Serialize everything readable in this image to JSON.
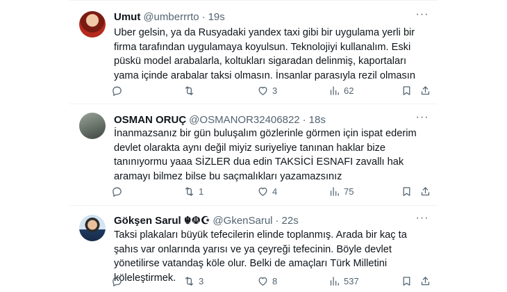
{
  "tweets": [
    {
      "name": "Umut",
      "handle": "@umberrrto",
      "dot": "·",
      "time": "19s",
      "text": "Uber gelsin, ya da Rusyadaki yandex taxi gibi bir uygulama yerli bir firma tarafından uygulamaya koyulsun. Teknolojiyi kullanalım. Eski püskü model arabalarla, koltukları sigaradan delinmiş, kaportaları yama içinde arabalar taksi olmasın. İnsanlar parasıyla rezil olmasın",
      "replies": "",
      "retweets": "",
      "likes": "3",
      "views": "62"
    },
    {
      "name": "OSMAN ORUÇ",
      "handle": "@OSMANOR32406822",
      "dot": "·",
      "time": "18s",
      "text": "İnanmazsanız bir gün buluşalım gözlerinle görmen için ispat ederim devlet olarakta aynı değil miyiz suriyeliye tanınan haklar bize tanınıyormu yaaa SİZLER dua edin TAKSİCİ ESNAFI zavallı hak aramayı bilmez bilse bu saçmalıkları yazamazsınız",
      "replies": "",
      "retweets": "1",
      "likes": "4",
      "views": "75"
    },
    {
      "name": "Gökşen Sarul ☬☫☪",
      "handle": "@GkenSarul",
      "dot": "·",
      "time": "22s",
      "text": "Taksi plakaları büyük tefecilerin elinde toplanmış. Arada bir kaç ta şahıs var onlarında yarısı ve ya çeyreği tefecinin. Böyle devlet yönetilirse vatandaş köle olur. Belki de amaçları Türk Milletini köleleştirmek.",
      "replies": "",
      "retweets": "3",
      "likes": "8",
      "views": "537"
    }
  ],
  "icons": {
    "reply": "reply-icon",
    "retweet": "retweet-icon",
    "like": "like-icon",
    "views": "views-icon",
    "bookmark": "bookmark-icon",
    "share": "share-icon",
    "more": "more-icon"
  },
  "more_glyph": "···"
}
